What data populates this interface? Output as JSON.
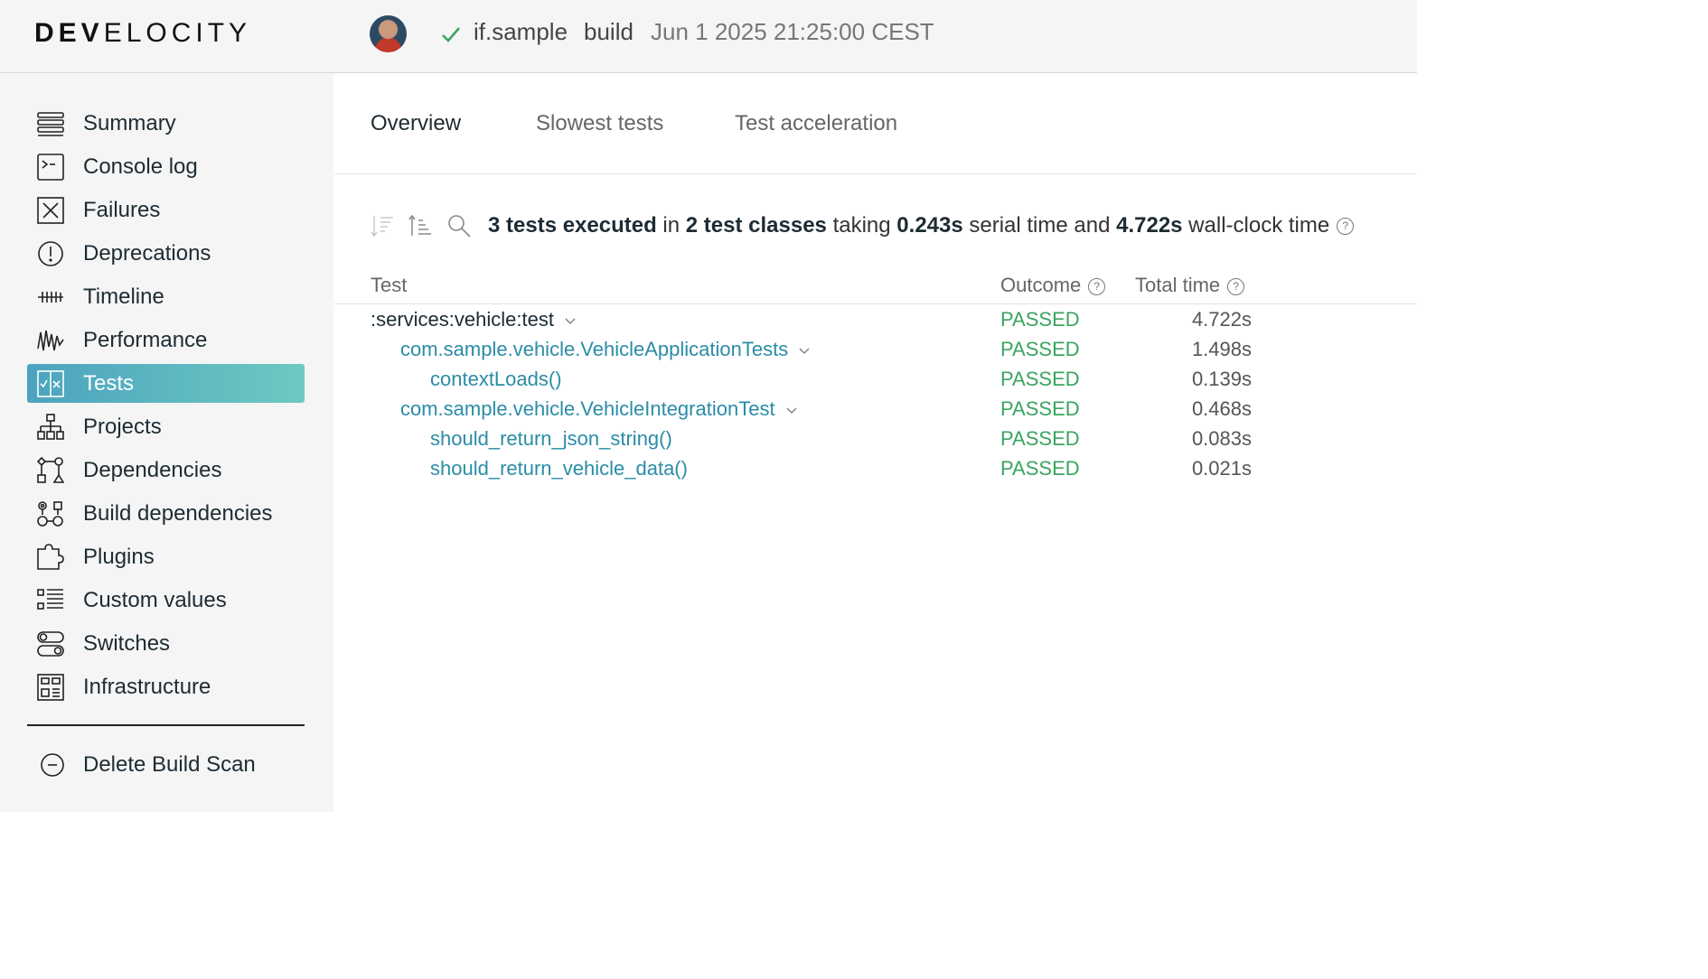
{
  "header": {
    "logo_text": "DEVELOCITY",
    "project": "if.sample",
    "task": "build",
    "timestamp": "Jun 1 2025 21:25:00 CEST",
    "status_color": "#3aa460"
  },
  "sidebar": {
    "items": [
      {
        "label": "Summary",
        "icon": "list-icon"
      },
      {
        "label": "Console log",
        "icon": "terminal-icon"
      },
      {
        "label": "Failures",
        "icon": "x-box-icon"
      },
      {
        "label": "Deprecations",
        "icon": "exclamation-icon"
      },
      {
        "label": "Timeline",
        "icon": "timeline-icon"
      },
      {
        "label": "Performance",
        "icon": "waveform-icon"
      },
      {
        "label": "Tests",
        "icon": "tests-icon",
        "active": true
      },
      {
        "label": "Projects",
        "icon": "hierarchy-icon"
      },
      {
        "label": "Dependencies",
        "icon": "dependencies-icon"
      },
      {
        "label": "Build dependencies",
        "icon": "build-dependencies-icon"
      },
      {
        "label": "Plugins",
        "icon": "puzzle-icon"
      },
      {
        "label": "Custom values",
        "icon": "custom-values-icon"
      },
      {
        "label": "Switches",
        "icon": "toggle-icon"
      },
      {
        "label": "Infrastructure",
        "icon": "infrastructure-icon"
      }
    ],
    "delete_label": "Delete Build Scan"
  },
  "tabs": [
    {
      "label": "Overview",
      "active": true
    },
    {
      "label": "Slowest tests"
    },
    {
      "label": "Test acceleration"
    }
  ],
  "summary": {
    "tests_count": "3 tests executed",
    "in_text": " in ",
    "classes_count": "2 test classes",
    "taking_text": " taking ",
    "serial_time": "0.243s",
    "serial_text": " serial time and ",
    "wall_time": "4.722s",
    "wall_text": " wall-clock time"
  },
  "table": {
    "headers": {
      "test": "Test",
      "outcome": "Outcome",
      "total_time": "Total time"
    },
    "rows": [
      {
        "name": ":services:vehicle:test",
        "outcome": "PASSED",
        "time": "4.722s"
      },
      {
        "name": "com.sample.vehicle.VehicleApplicationTests",
        "outcome": "PASSED",
        "time": "1.498s"
      },
      {
        "name": "contextLoads()",
        "outcome": "PASSED",
        "time": "0.139s"
      },
      {
        "name": "com.sample.vehicle.VehicleIntegrationTest",
        "outcome": "PASSED",
        "time": "0.468s"
      },
      {
        "name": "should_return_json_string()",
        "outcome": "PASSED",
        "time": "0.083s"
      },
      {
        "name": "should_return_vehicle_data()",
        "outcome": "PASSED",
        "time": "0.021s"
      }
    ]
  }
}
